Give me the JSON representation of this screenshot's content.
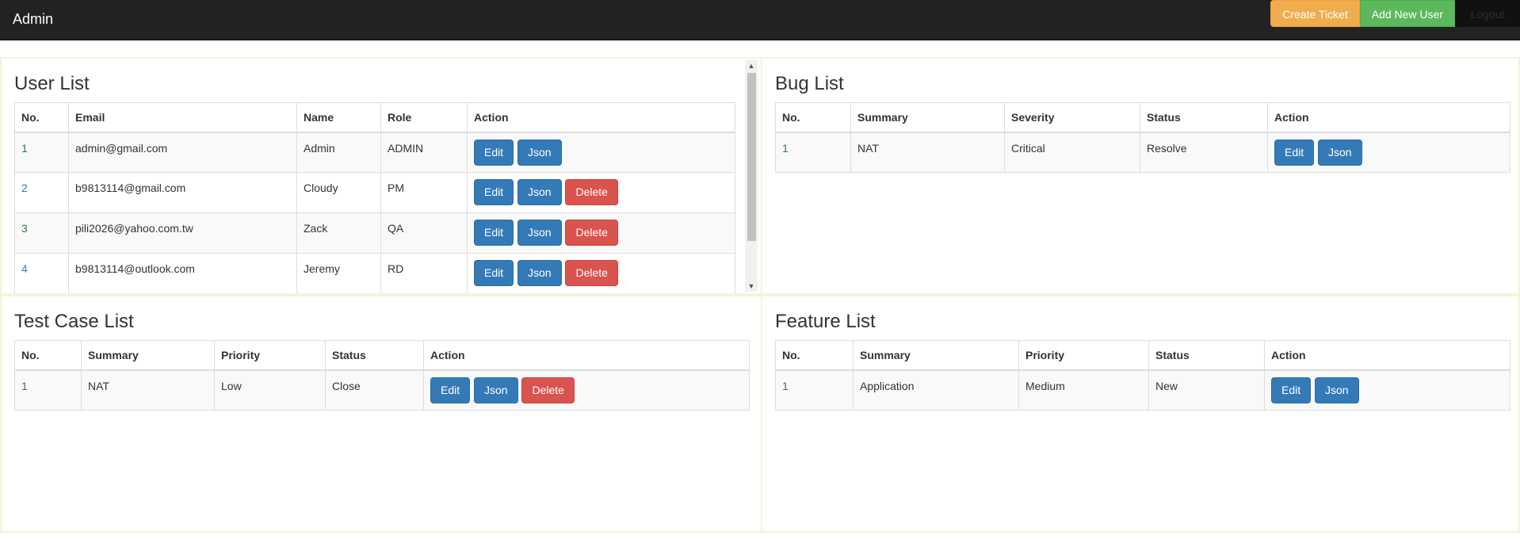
{
  "navbar": {
    "brand": "Admin",
    "create_ticket": "Create Ticket",
    "add_user": "Add New User",
    "logout": "Logout"
  },
  "buttons": {
    "edit": "Edit",
    "json": "Json",
    "delete": "Delete"
  },
  "user_list": {
    "title": "User List",
    "headers": [
      "No.",
      "Email",
      "Name",
      "Role",
      "Action"
    ],
    "rows": [
      {
        "no": "1",
        "email": "admin@gmail.com",
        "name": "Admin",
        "role": "ADMIN"
      },
      {
        "no": "2",
        "email": "b9813114@gmail.com",
        "name": "Cloudy",
        "role": "PM"
      },
      {
        "no": "3",
        "email": "pili2026@yahoo.com.tw",
        "name": "Zack",
        "role": "QA"
      },
      {
        "no": "4",
        "email": "b9813114@outlook.com",
        "name": "Jeremy",
        "role": "RD"
      }
    ]
  },
  "bug_list": {
    "title": "Bug List",
    "headers": [
      "No.",
      "Summary",
      "Severity",
      "Status",
      "Action"
    ],
    "rows": [
      {
        "no": "1",
        "summary": "NAT",
        "severity": "Critical",
        "status": "Resolve"
      }
    ]
  },
  "test_case_list": {
    "title": "Test Case List",
    "headers": [
      "No.",
      "Summary",
      "Priority",
      "Status",
      "Action"
    ],
    "rows": [
      {
        "no": "1",
        "summary": "NAT",
        "priority": "Low",
        "status": "Close"
      }
    ]
  },
  "feature_list": {
    "title": "Feature List",
    "headers": [
      "No.",
      "Summary",
      "Priority",
      "Status",
      "Action"
    ],
    "rows": [
      {
        "no": "1",
        "summary": "Application",
        "priority": "Medium",
        "status": "New"
      }
    ]
  },
  "colors": {
    "navbar": "#222222",
    "primary": "#337ab7",
    "danger": "#d9534f",
    "warning": "#f0ad4e",
    "success": "#5cb85c"
  }
}
